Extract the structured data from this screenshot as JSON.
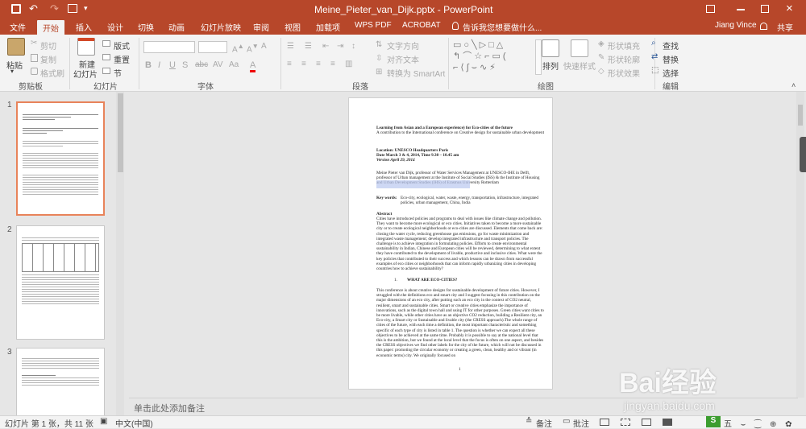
{
  "titlebar": {
    "title": "Meine_Pieter_van_Dijk.pptx - PowerPoint"
  },
  "tabs": [
    {
      "label": "文件"
    },
    {
      "label": "开始"
    },
    {
      "label": "插入"
    },
    {
      "label": "设计"
    },
    {
      "label": "切换"
    },
    {
      "label": "动画"
    },
    {
      "label": "幻灯片放映"
    },
    {
      "label": "审阅"
    },
    {
      "label": "视图"
    },
    {
      "label": "加载项"
    },
    {
      "label": "WPS PDF"
    },
    {
      "label": "ACROBAT"
    },
    {
      "label": "告诉我您想要做什么..."
    }
  ],
  "user": {
    "name": "Jiang Vince",
    "share_label": "共享"
  },
  "ribbon": {
    "clipboard": {
      "paste": "粘贴",
      "cut": "剪切",
      "copy": "复制",
      "format_painter": "格式刷",
      "group": "剪贴板"
    },
    "slides": {
      "new_slide": "新建",
      "new_slide2": "幻灯片",
      "layout": "版式",
      "reset": "重置",
      "section": "节",
      "group": "幻灯片"
    },
    "font": {
      "group": "字体"
    },
    "paragraph": {
      "text_direction": "文字方向",
      "align_text": "对齐文本",
      "smartart": "转换为 SmartArt",
      "group": "段落"
    },
    "drawing": {
      "arrange": "排列",
      "quick_styles": "快速样式",
      "shape_fill": "形状填充",
      "shape_outline": "形状轮廓",
      "shape_effects": "形状效果",
      "group": "绘图"
    },
    "editing": {
      "find": "查找",
      "replace": "替换",
      "select": "选择",
      "group": "编辑"
    }
  },
  "thumbnails": [
    {
      "num": "1"
    },
    {
      "num": "2"
    },
    {
      "num": "3"
    }
  ],
  "slide": {
    "title": "Learning from Asian and a European experience) for Eco-cities of the future",
    "subtitle": "A contribution to the International conference on Creative design for sustainable urban development",
    "location": "Location: UNESCO Headquarters Paris",
    "date": "Date March 3 & 4, 2014, Time 9.30 – 10.45 am",
    "version": "Version April 29, 2014",
    "author": "Meine Pieter van Dijk, professor of Water Services Management at UNESCO-IHE in Delft, professor of Urban management at the Institute of Social Studies (ISS) & the Institute of Housing and Urban Development Studies (IHS) of Erasmus University Rotterdam",
    "keywords_label": "Key words:",
    "keywords": "Eco-city, ecological, water, waste, energy, transportation, infrastructure, integrated policies, urban management, China, India",
    "abstract_label": "Abstract",
    "abstract": "Cities have introduced policies and programs to deal with issues like climate change and pollution. They want to become more ecological or eco cities. Initiatives taken to become a more sustainable city or to create ecological neighborhoods or eco-cities are discussed. Elements that come back are: closing the water cycle, reducing greenhouse gas emissions, go for waste minimization and integrated waste management; develop integrated infrastructure and transport policies. The challenge is to achieve integration in formulating policies. Efforts to create environmental sustainability in Indian, Chinese and European cities will be reviewed, determining to what extent they have contributed to the development of livable, productive and inclusive cities. What were the key policies that contributed to their success and which lessons can be drawn from successful examples of eco cities or neighborhoods that can inform rapidly urbanizing cities in developing countries how to achieve sustainability?",
    "section_num": "1.",
    "section_title": "WHAT ARE ECO-CITIES?",
    "body": "This conference is about creative designs for sustainable development of future cities. However, I struggled with the definitions eco and smart city and I suggest focusing in this contribution on the major dimensions of an eco city, after putting such an eco city in the context of CO2 neutral, resilient, smart and sustainable cities. Smart or creative cities emphasize the importance of innovations, such as the digital town hall and using IT for other purposes. Green cities want cities to be more livable, while other cities have as an objective CO2 reduction, building a Resilient city, an Eco-city, a Smart city or Sustainable and livable city (the CRESS approach).The whole range of cities of the future, with each time a definition, the most important characteristic and something specific of each type of city is listed in table 1. The question is whether we can expect all these objectives to be achieved at the same time. Probably it is possible to say at the national level that this is the ambition, but we found at the local level that the focus is often on one aspect, and besides the CRESS objectives we find other labels for the city of the future, which will not be discussed in this paper: promoting the circular economy or creating a green, clean, healthy and or vibrant (in economic terms) city. We originally focused on",
    "page_num": "1"
  },
  "notes": {
    "placeholder": "单击此处添加备注"
  },
  "status": {
    "slide_info": "幻灯片 第 1 张，共 11 张",
    "language": "中文(中国)",
    "notes_btn": "备注",
    "comments_btn": "批注"
  },
  "watermark": {
    "text": "Bai经验",
    "sub": "jingyan.baidu.com"
  }
}
